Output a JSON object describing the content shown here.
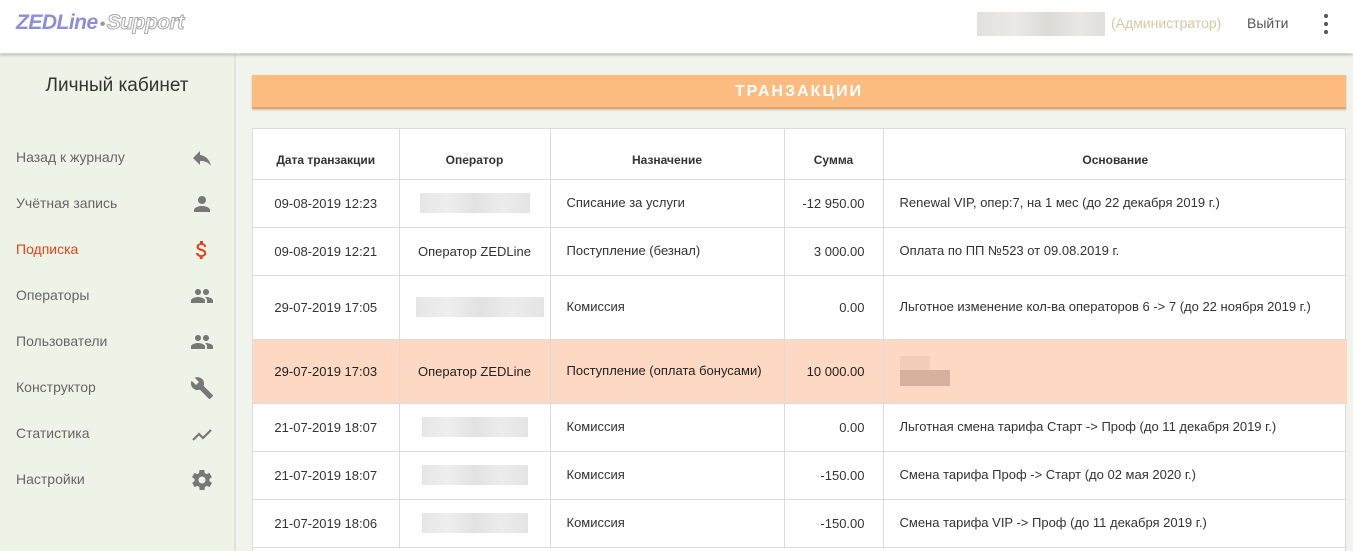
{
  "header": {
    "logo_main": "ZEDLine",
    "logo_sep": "•",
    "logo_sub": "Support",
    "role": "(Администратор)",
    "logout_label": "Выйти",
    "menu_icon": "more-vert-icon"
  },
  "sidebar": {
    "title": "Личный кабинет",
    "active_color": "#e2441d",
    "items": [
      {
        "label": "Назад к журналу",
        "icon": "reply-icon"
      },
      {
        "label": "Учётная запись",
        "icon": "person-icon"
      },
      {
        "label": "Подписка",
        "icon": "dollar-icon"
      },
      {
        "label": "Операторы",
        "icon": "group-icon"
      },
      {
        "label": "Пользователи",
        "icon": "group-icon"
      },
      {
        "label": "Конструктор",
        "icon": "wrench-icon"
      },
      {
        "label": "Статистика",
        "icon": "trending-up-icon"
      },
      {
        "label": "Настройки",
        "icon": "gear-icon"
      }
    ]
  },
  "main": {
    "section_title": "ТРАНЗАКЦИИ",
    "section_color": "#fdbc7f",
    "highlight_color": "#fdd8c2",
    "columns": [
      "Дата транзакции",
      "Оператор",
      "Назначение",
      "Сумма",
      "Основание"
    ],
    "rows": [
      {
        "date": "09-08-2019 12:23",
        "operator": "",
        "purpose": "Списание за услуги",
        "amount": "-12 950.00",
        "basis": "Renewal VIP, опер:7, на 1 мес (до 22 декабря 2019 г.)"
      },
      {
        "date": "09-08-2019 12:21",
        "operator": "Оператор ZEDLine",
        "purpose": "Поступление (безнал)",
        "amount": "3 000.00",
        "basis": "Оплата по ПП №523 от 09.08.2019 г."
      },
      {
        "date": "29-07-2019 17:05",
        "operator": "",
        "purpose": "Комиссия",
        "amount": "0.00",
        "basis": "Льготное изменение кол-ва операторов 6 -> 7 (до 22 ноября 2019 г.)"
      },
      {
        "date": "29-07-2019 17:03",
        "operator": "Оператор ZEDLine",
        "purpose": "Поступление (оплата бонусами)",
        "amount": "10 000.00",
        "basis": ""
      },
      {
        "date": "21-07-2019 18:07",
        "operator": "",
        "purpose": "Комиссия",
        "amount": "0.00",
        "basis": "Льготная смена тарифа Старт -> Проф (до 11 декабря 2019 г.)"
      },
      {
        "date": "21-07-2019 18:07",
        "operator": "",
        "purpose": "Комиссия",
        "amount": "-150.00",
        "basis": "Смена тарифа Проф -> Старт (до 02 мая 2020 г.)"
      },
      {
        "date": "21-07-2019 18:06",
        "operator": "",
        "purpose": "Комиссия",
        "amount": "-150.00",
        "basis": "Смена тарифа VIP -> Проф (до 11 декабря 2019 г.)"
      }
    ]
  }
}
